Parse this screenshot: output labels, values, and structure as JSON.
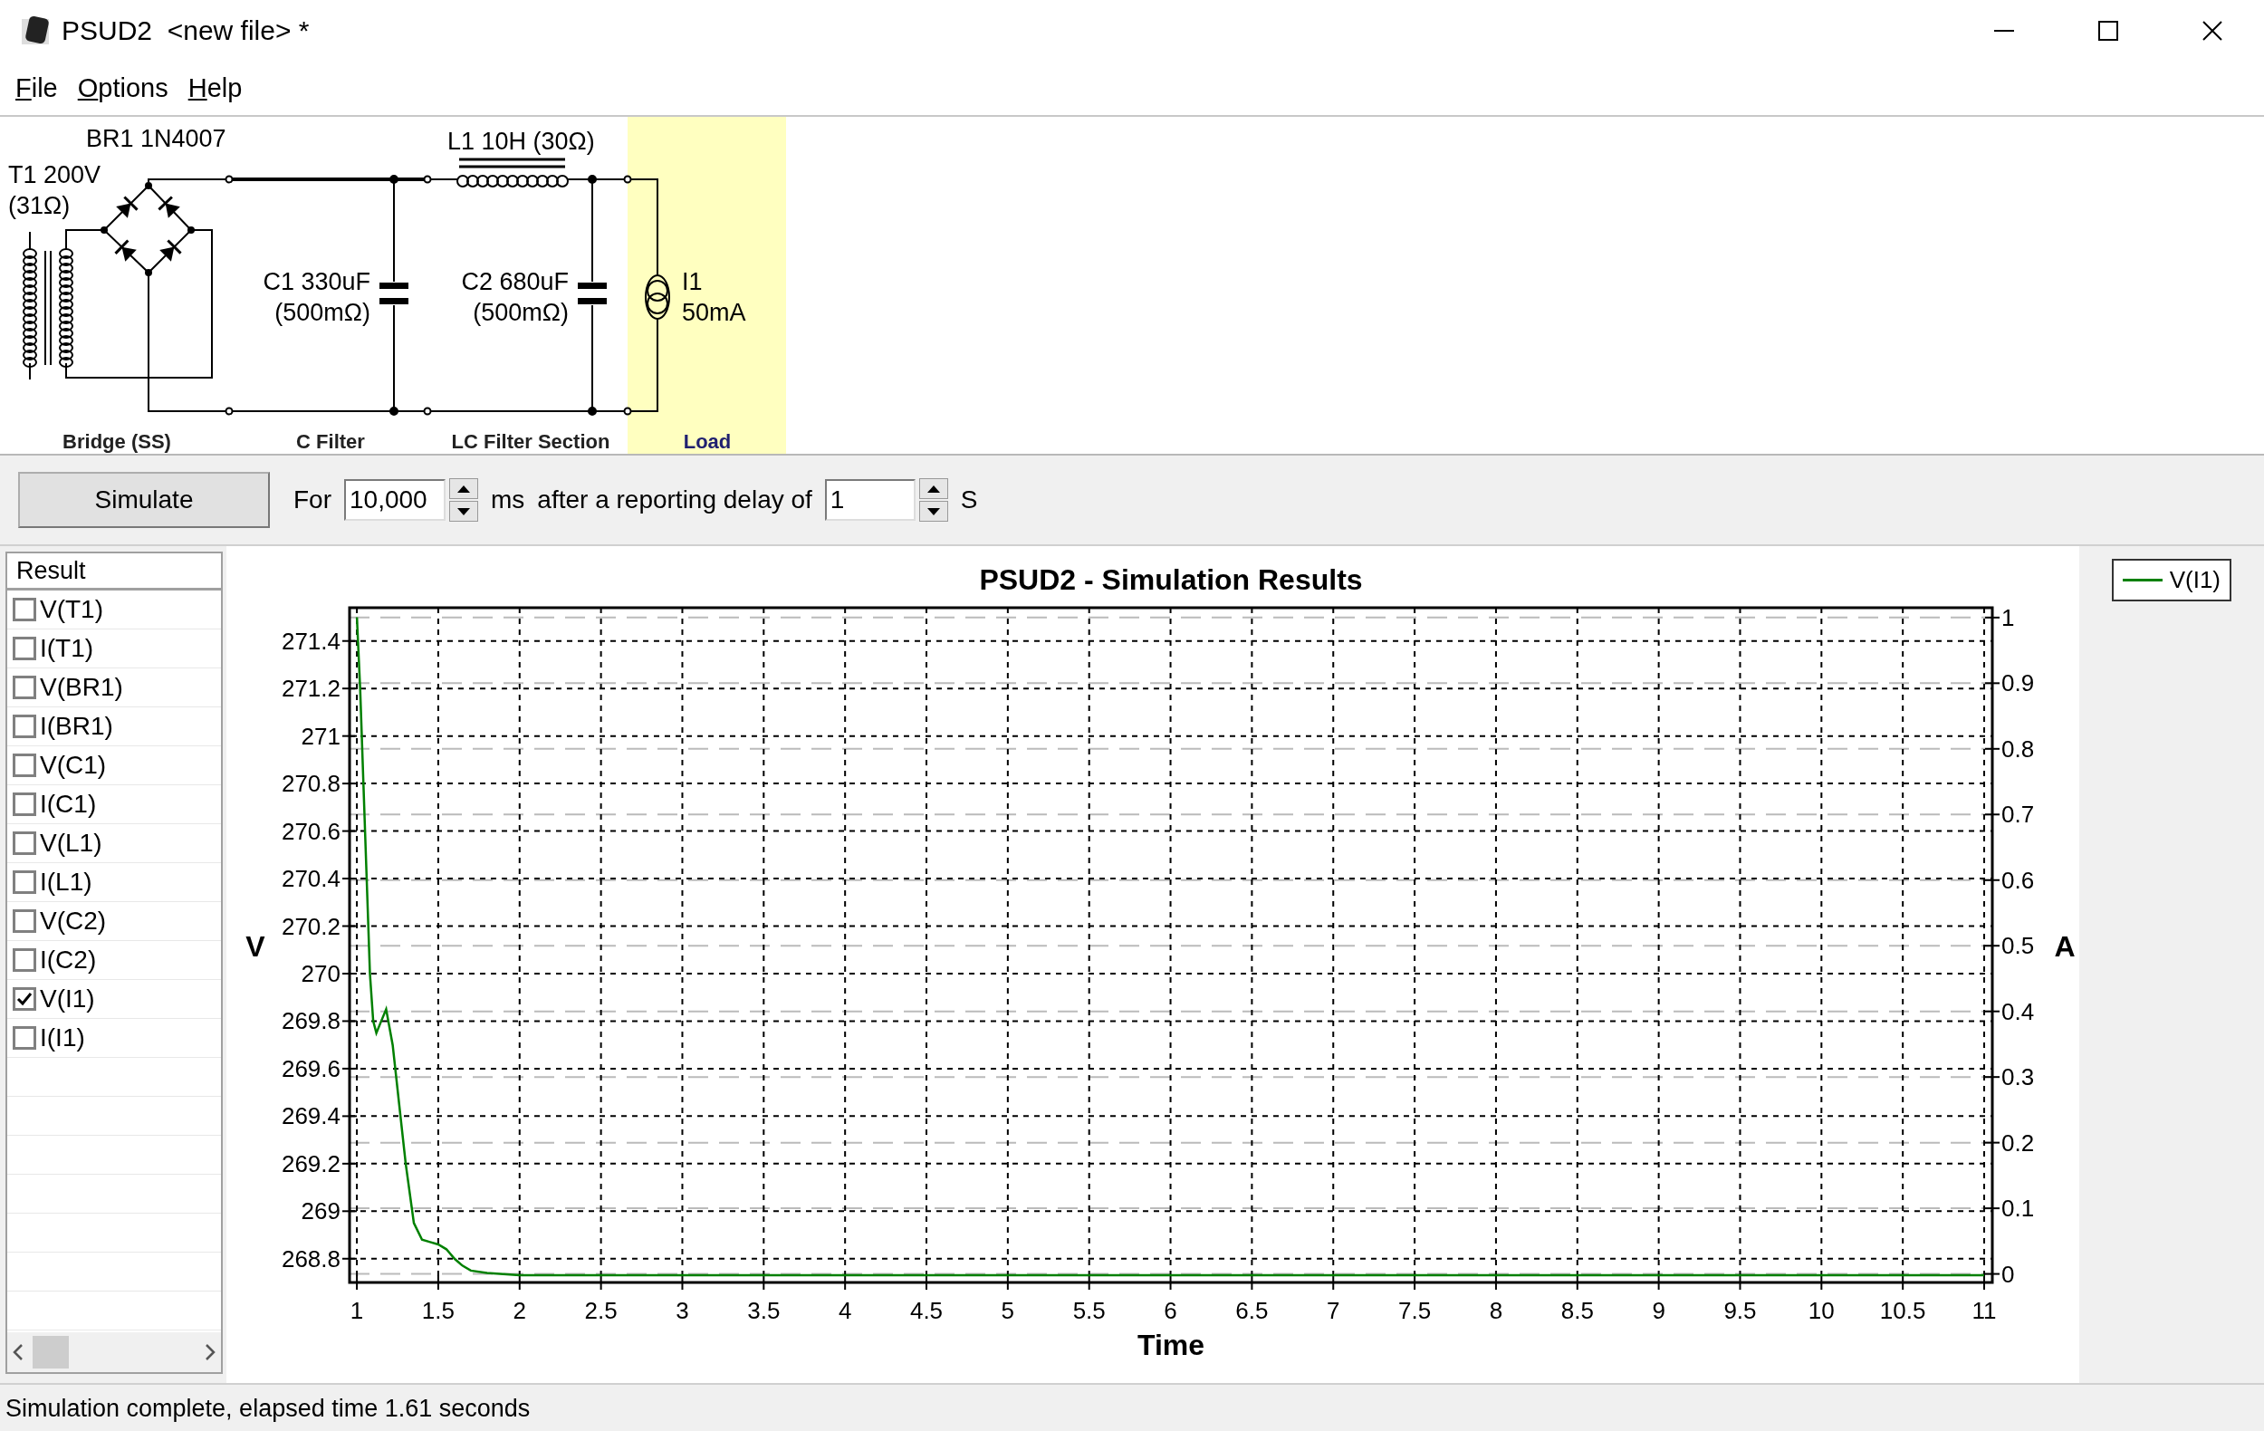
{
  "window": {
    "title": "PSUD2  <new file> *"
  },
  "menu": [
    {
      "label": "File"
    },
    {
      "label": "Options"
    },
    {
      "label": "Help"
    }
  ],
  "schematic": {
    "transformer": {
      "name": "T1 200V",
      "resistance": "(31Ω)"
    },
    "bridge": {
      "name": "BR1 1N4007"
    },
    "inductor": {
      "name": "L1 10H (30Ω)"
    },
    "capacitors": [
      {
        "name": "C1 330uF",
        "esr": "(500mΩ)"
      },
      {
        "name": "C2 680uF",
        "esr": "(500mΩ)"
      }
    ],
    "load": {
      "name": "I1",
      "value": "50mA"
    },
    "sections": [
      "Bridge (SS)",
      "C Filter",
      "LC Filter Section",
      "Load"
    ]
  },
  "toolbar": {
    "simulate_button": "Simulate",
    "for_label": "For",
    "duration": "10,000",
    "duration_unit": "ms",
    "delay_label": "after a reporting delay of",
    "delay": "1",
    "delay_unit": "S"
  },
  "results": {
    "header": "Result",
    "items": [
      {
        "label": "V(T1)",
        "checked": false
      },
      {
        "label": "I(T1)",
        "checked": false
      },
      {
        "label": "V(BR1)",
        "checked": false
      },
      {
        "label": "I(BR1)",
        "checked": false
      },
      {
        "label": "V(C1)",
        "checked": false
      },
      {
        "label": "I(C1)",
        "checked": false
      },
      {
        "label": "V(L1)",
        "checked": false
      },
      {
        "label": "I(L1)",
        "checked": false
      },
      {
        "label": "V(C2)",
        "checked": false
      },
      {
        "label": "I(C2)",
        "checked": false
      },
      {
        "label": "V(I1)",
        "checked": true
      },
      {
        "label": "I(I1)",
        "checked": false
      }
    ]
  },
  "chart": {
    "chart_data": {
      "type": "line",
      "title": "PSUD2 - Simulation Results",
      "xlabel": "Time",
      "ylabel": "V",
      "y2label": "A",
      "x": [
        1,
        1.02,
        1.04,
        1.06,
        1.08,
        1.1,
        1.12,
        1.15,
        1.18,
        1.22,
        1.26,
        1.3,
        1.35,
        1.4,
        1.45,
        1.5,
        1.55,
        1.6,
        1.65,
        1.7,
        1.8,
        2,
        3,
        5,
        7,
        9,
        11
      ],
      "series": [
        {
          "name": "V(I1)",
          "color": "#008000",
          "values": [
            271.5,
            271.2,
            270.8,
            270.4,
            270.0,
            269.8,
            269.75,
            269.8,
            269.85,
            269.7,
            269.45,
            269.2,
            268.95,
            268.88,
            268.87,
            268.86,
            268.84,
            268.8,
            268.77,
            268.75,
            268.74,
            268.73,
            268.73,
            268.73,
            268.73,
            268.73,
            268.73
          ]
        }
      ],
      "grid": true,
      "xlim": [
        0.955,
        11.05
      ],
      "ylim": [
        268.7,
        271.54
      ],
      "y2lim": [
        -0.013,
        1.015
      ],
      "xticks": [
        1,
        1.5,
        2,
        2.5,
        3,
        3.5,
        4,
        4.5,
        5,
        5.5,
        6,
        6.5,
        7,
        7.5,
        8,
        8.5,
        9,
        9.5,
        10,
        10.5,
        11
      ],
      "yticks": [
        268.8,
        269,
        269.2,
        269.4,
        269.6,
        269.8,
        270,
        270.2,
        270.4,
        270.6,
        270.8,
        271,
        271.2,
        271.4
      ],
      "y2ticks": [
        0,
        0.1,
        0.2,
        0.3,
        0.4,
        0.5,
        0.6,
        0.7,
        0.8,
        0.9,
        1
      ]
    }
  },
  "status_bar": {
    "text": "Simulation complete, elapsed time 1.61 seconds"
  }
}
